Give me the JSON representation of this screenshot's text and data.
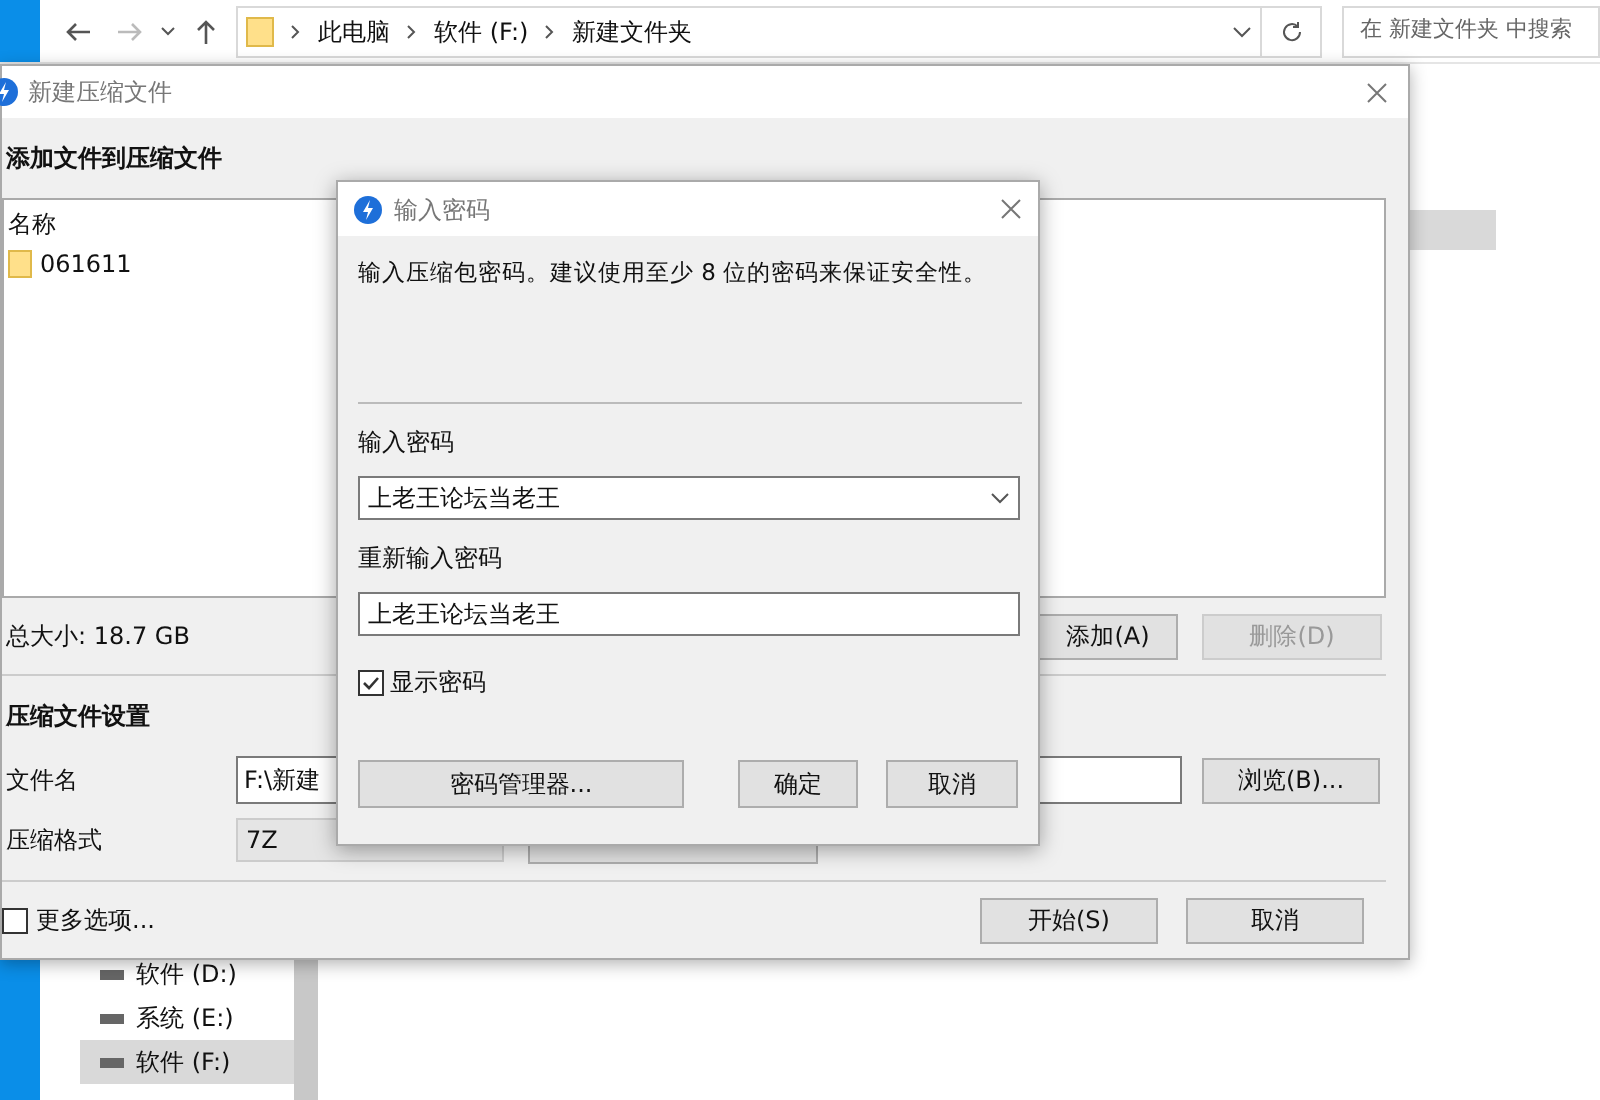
{
  "explorer": {
    "breadcrumbs": [
      "此电脑",
      "软件 (F:)",
      "新建文件夹"
    ],
    "search": {
      "placeholder": "在 新建文件夹 中搜索"
    },
    "nav_items": [
      {
        "label": "软件 (D:)",
        "selected": false
      },
      {
        "label": "系统 (E:)",
        "selected": false
      },
      {
        "label": "软件 (F:)",
        "selected": true
      }
    ]
  },
  "archive_dialog": {
    "title": "新建压缩文件",
    "heading": "添加文件到压缩文件",
    "file_list": {
      "columns": [
        "名称"
      ],
      "rows": [
        {
          "name": "061611"
        }
      ]
    },
    "total_size": "总大小: 18.7 GB",
    "list_buttons": [
      {
        "label": "添加(A)",
        "disabled": false
      },
      {
        "label": "删除(D)",
        "disabled": true
      }
    ],
    "settings_heading": "压缩文件设置",
    "filename": {
      "label": "文件名",
      "value": "F:\\新建"
    },
    "browse_button": "浏览(B)...",
    "format": {
      "label": "压缩格式",
      "value": "7Z"
    },
    "more_options": {
      "label": "更多选项...",
      "checked": false
    },
    "footer_buttons": [
      "开始(S)",
      "取消"
    ]
  },
  "password_dialog": {
    "title": "输入密码",
    "message": "输入压缩包密码。建议使用至少 8 位的密码来保证安全性。",
    "password": {
      "label": "输入密码",
      "value": "上老王论坛当老王"
    },
    "confirm_password": {
      "label": "重新输入密码",
      "value": "上老王论坛当老王"
    },
    "show_password": {
      "label": "显示密码",
      "checked": true
    },
    "buttons": [
      "密码管理器...",
      "确定",
      "取消"
    ]
  }
}
